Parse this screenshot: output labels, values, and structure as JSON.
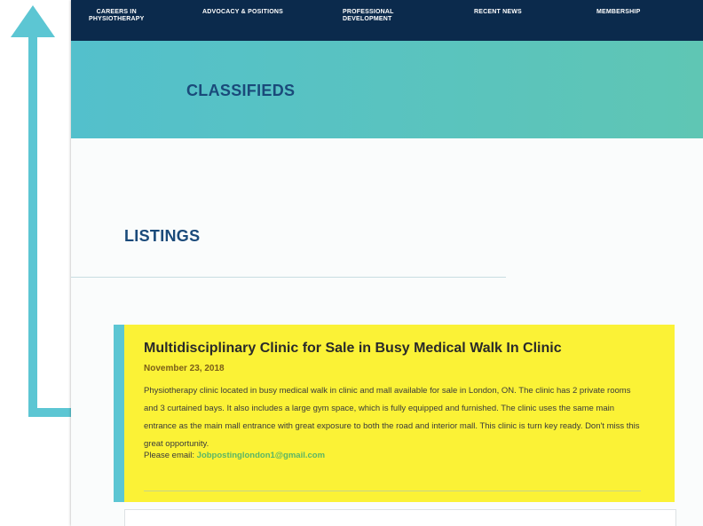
{
  "nav": {
    "items": [
      {
        "label": "CAREERS IN\nPHYSIOTHERAPY"
      },
      {
        "label": "ADVOCACY & POSITIONS"
      },
      {
        "label": "PROFESSIONAL\nDEVELOPMENT"
      },
      {
        "label": "RECENT NEWS"
      },
      {
        "label": "MEMBERSHIP"
      }
    ]
  },
  "banner": {
    "title": "CLASSIFIEDS"
  },
  "section": {
    "title": "LISTINGS"
  },
  "listing": {
    "title": "Multidisciplinary Clinic for Sale in Busy Medical Walk In Clinic",
    "date": "November 23, 2018",
    "body": "Physiotherapy clinic located in busy medical walk in clinic and mall available for sale in London, ON. The clinic has 2 private rooms and 3 curtained bays. It also includes a large gym space, which is fully equipped and furnished. The clinic uses the same main entrance as the main mall entrance with great exposure to both the road and interior mall. This clinic is turn key ready. Don't miss this great opportunity.",
    "email_label": "Please email:",
    "email": "Jobpostinglondon1@gmail.com"
  },
  "colors": {
    "nav_bg": "#0b2a4c",
    "banner_start": "#53c0cc",
    "banner_end": "#5fc6b4",
    "highlight": "#fbf236",
    "arrow": "#5cc6d3",
    "title_blue": "#1a4a7a",
    "email_green": "#5bb565"
  },
  "icons": {
    "annotation": "up-arrow-icon"
  }
}
